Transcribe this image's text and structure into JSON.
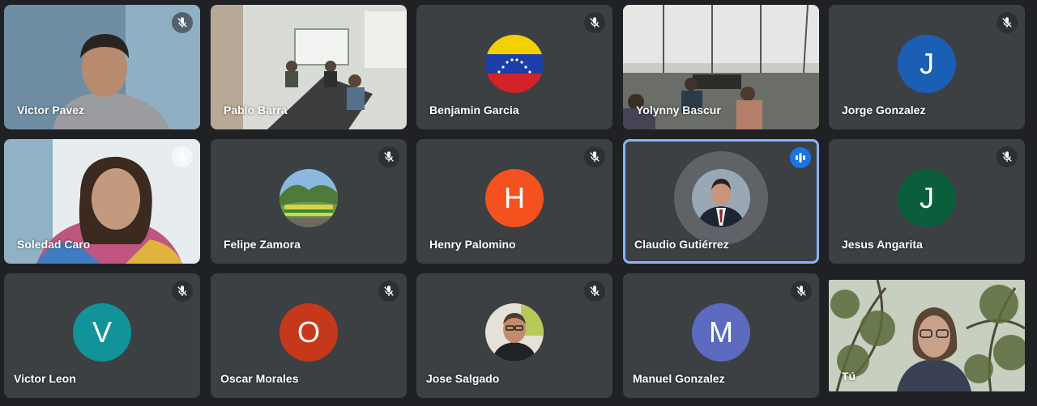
{
  "participants": [
    {
      "name": "Victor Pavez",
      "muted": true,
      "kind": "video",
      "scene": "person-blue"
    },
    {
      "name": "Pablo Barra",
      "muted": false,
      "kind": "video",
      "scene": "room"
    },
    {
      "name": "Benjamin Garcia",
      "muted": true,
      "kind": "flag"
    },
    {
      "name": "Yolynny Bascur",
      "muted": false,
      "kind": "video",
      "scene": "office"
    },
    {
      "name": "Jorge Gonzalez",
      "muted": true,
      "kind": "initial",
      "initial": "J",
      "color": "#1a5fb4"
    },
    {
      "name": "Soledad Caro",
      "muted": true,
      "kind": "video",
      "scene": "person-light"
    },
    {
      "name": "Felipe Zamora",
      "muted": true,
      "kind": "photo",
      "photo": "train-landscape"
    },
    {
      "name": "Henry Palomino",
      "muted": true,
      "kind": "initial",
      "initial": "H",
      "color": "#f4511e"
    },
    {
      "name": "Claudio Gutiérrez",
      "muted": false,
      "speaking": true,
      "kind": "photo",
      "photo": "man-suit"
    },
    {
      "name": "Jesus Angarita",
      "muted": true,
      "kind": "initial",
      "initial": "J",
      "color": "#0b5e3c"
    },
    {
      "name": "Victor Leon",
      "muted": true,
      "kind": "initial",
      "initial": "V",
      "color": "#12939a"
    },
    {
      "name": "Oscar Morales",
      "muted": true,
      "kind": "initial",
      "initial": "O",
      "color": "#c5391a"
    },
    {
      "name": "Jose Salgado",
      "muted": true,
      "kind": "photo",
      "photo": "man-selfie"
    },
    {
      "name": "Manuel Gonzalez",
      "muted": true,
      "kind": "initial",
      "initial": "M",
      "color": "#5c6bc0"
    },
    {
      "name": "Tú",
      "muted": false,
      "kind": "video",
      "scene": "person-forest"
    }
  ],
  "icons": {
    "muted": "mic-off-icon",
    "speaking": "audio-level-icon"
  }
}
